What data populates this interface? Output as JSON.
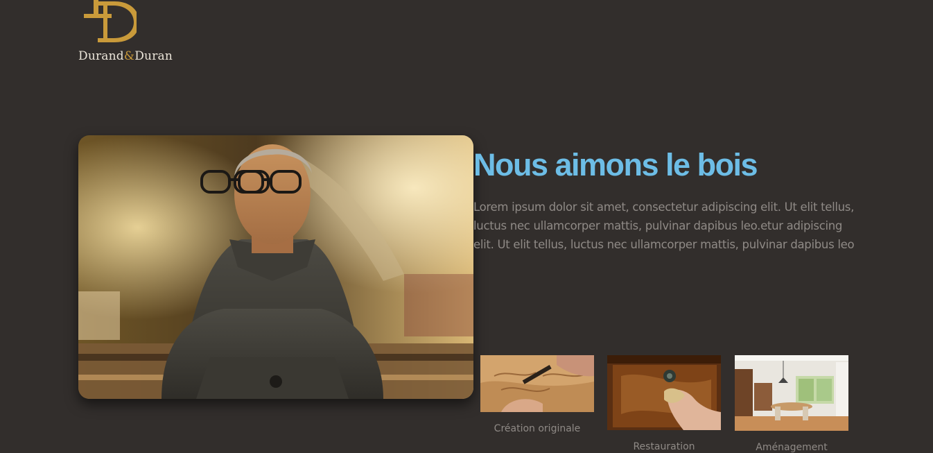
{
  "brand": {
    "name_part1": "Durand",
    "ampersand": "&",
    "name_part2": "Duran",
    "accent_color": "#c99a3a"
  },
  "hero": {
    "image": "craftsman-portrait-photo"
  },
  "main": {
    "title": "Nous aimons le bois",
    "description": "Lorem ipsum dolor sit amet, consectetur adipiscing elit. Ut elit tellus, luctus nec ullamcorper mattis, pulvinar dapibus leo.etur adipiscing elit. Ut elit tellus, luctus nec ullamcorper mattis, pulvinar dapibus leo",
    "title_color": "#6dbde6"
  },
  "services": [
    {
      "label": "Création originale",
      "image": "wood-carving-photo"
    },
    {
      "label": "Restauration",
      "image": "furniture-polishing-photo"
    },
    {
      "label": "Aménagement",
      "image": "dining-room-photo"
    }
  ]
}
